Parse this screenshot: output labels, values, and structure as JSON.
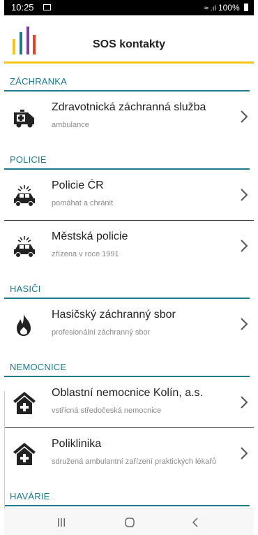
{
  "status_bar": {
    "time": "10:25",
    "battery_text": "100%",
    "icons": [
      "image-icon",
      "wifi-icon",
      "signal-icon",
      "battery-icon"
    ]
  },
  "header": {
    "title": "SOS kontakty",
    "logo": "bars-logo-icon",
    "accent_color": "#f5c518",
    "logo_colors": [
      "#f5c518",
      "#1c7a8c",
      "#7a3fa0",
      "#e0452a"
    ]
  },
  "section_color": "#1c7a8c",
  "sections": [
    {
      "label": "ZÁCHRANKA",
      "items": [
        {
          "title": "Zdravotnická záchranná služba",
          "subtitle": "ambulance",
          "icon": "ambulance-icon"
        }
      ]
    },
    {
      "label": "POLICIE",
      "items": [
        {
          "title": "Policie ČR",
          "subtitle": "pomáhat a chránit",
          "icon": "police-car-icon"
        },
        {
          "title": "Městská policie",
          "subtitle": "zřízena v roce 1991",
          "icon": "police-car-icon"
        }
      ]
    },
    {
      "label": "HASIČI",
      "items": [
        {
          "title": "Hasičský záchranný sbor",
          "subtitle": "profesionální záchranný sbor",
          "icon": "fire-icon"
        }
      ]
    },
    {
      "label": "NEMOCNICE",
      "items": [
        {
          "title": "Oblastní nemocnice Kolín, a.s.",
          "subtitle": "vstřícná středočeská nemocnice",
          "icon": "hospital-icon"
        },
        {
          "title": "Poliklinika",
          "subtitle": "sdružená ambulantní zařízení praktických lékařů",
          "icon": "hospital-icon"
        }
      ]
    },
    {
      "label": "HAVÁRIE",
      "items": []
    }
  ],
  "nav_bar": {
    "buttons": [
      "recent-apps-icon",
      "home-icon",
      "back-icon"
    ]
  }
}
